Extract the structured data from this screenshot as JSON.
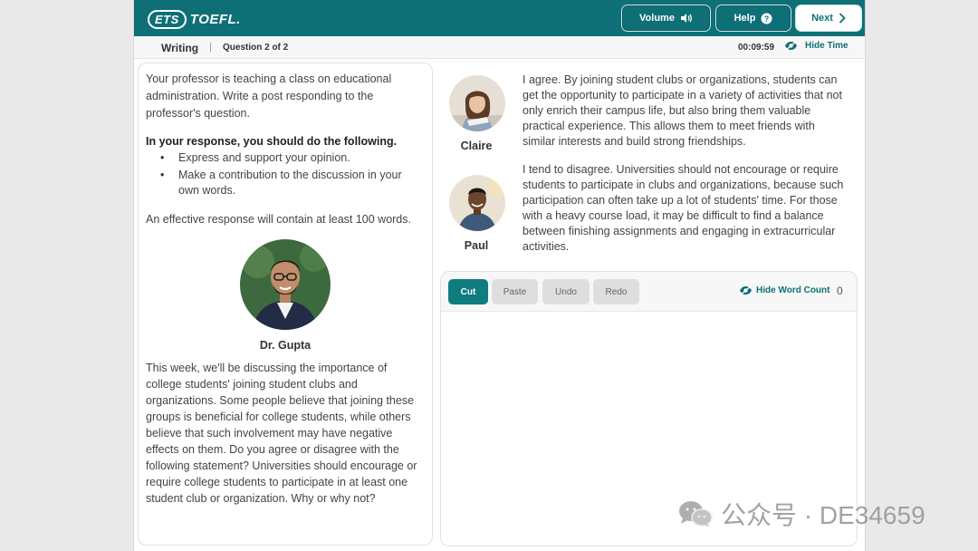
{
  "header": {
    "logo_ets": "ETS",
    "logo_toefl": "TOEFL.",
    "volume_label": "Volume",
    "help_label": "Help",
    "next_label": "Next"
  },
  "subbar": {
    "section": "Writing",
    "separator": "|",
    "question": "Question 2 of 2",
    "timer": "00:09:59",
    "hide_time_label": "Hide Time"
  },
  "prompt": {
    "intro": "Your professor is teaching a class on educational administration. Write a post responding to the professor's question.",
    "instructions_heading": "In your response, you should do the following.",
    "bullets": [
      "Express and support your opinion.",
      "Make a contribution to the discussion in your own words."
    ],
    "length_note": "An effective response will contain at least 100 words.",
    "professor_name": "Dr. Gupta",
    "professor_text": "This week, we'll be discussing the importance of college students' joining student clubs and organizations. Some people believe that joining these groups is beneficial for college students, while others believe that such involvement may have negative effects on them. Do you agree or disagree with the following statement? Universities should encourage or require college students to participate in at least one student club or organization. Why or why not?"
  },
  "students": [
    {
      "name": "Claire",
      "post": "I agree. By joining student clubs or organizations, students can get the opportunity to participate in a variety of activities that not only enrich their campus life, but also bring them valuable practical experience. This allows them to meet friends with similar interests and build strong friendships."
    },
    {
      "name": "Paul",
      "post": "I tend to disagree. Universities should not encourage or require students to participate in clubs and organizations, because such participation can often take up a lot of students' time. For those with a heavy course load, it may be difficult to find a balance between finishing assignments and engaging in extracurricular activities."
    }
  ],
  "editor": {
    "cut": "Cut",
    "paste": "Paste",
    "undo": "Undo",
    "redo": "Redo",
    "hide_word_count": "Hide Word Count",
    "word_count": "0",
    "text": ""
  },
  "watermark": {
    "text": "公众号 · DE34659"
  },
  "colors": {
    "accent": "#0f6f77"
  }
}
